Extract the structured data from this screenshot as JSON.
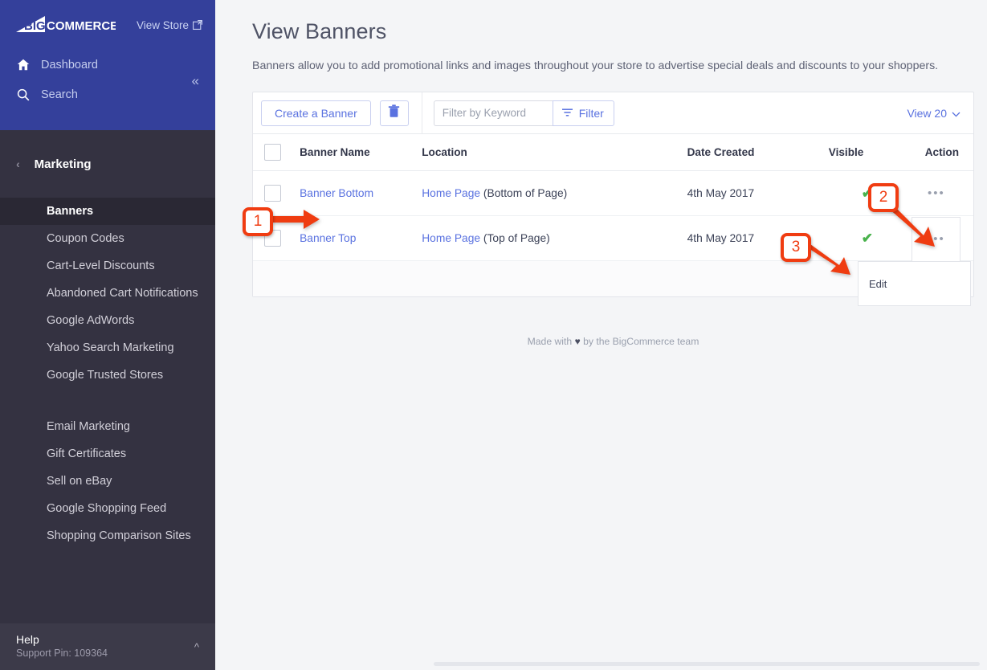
{
  "sidebar": {
    "brand": "BIGCOMMERCE",
    "view_store": "View Store",
    "view_store_icon": "external-link-icon",
    "nav": [
      {
        "label": "Dashboard",
        "icon": "home-icon"
      },
      {
        "label": "Search",
        "icon": "search-icon"
      }
    ],
    "collapse_icon": "chevron-double-left-icon",
    "section": {
      "label": "Marketing",
      "back_icon": "chevron-left-icon"
    },
    "items": [
      {
        "label": "Banners",
        "active": true
      },
      {
        "label": "Coupon Codes",
        "active": false
      },
      {
        "label": "Cart-Level Discounts",
        "active": false
      },
      {
        "label": "Abandoned Cart Notifications",
        "active": false
      },
      {
        "label": "Google AdWords",
        "active": false
      },
      {
        "label": "Yahoo Search Marketing",
        "active": false
      },
      {
        "label": "Google Trusted Stores",
        "active": false
      }
    ],
    "items2": [
      {
        "label": "Email Marketing"
      },
      {
        "label": "Gift Certificates"
      },
      {
        "label": "Sell on eBay"
      },
      {
        "label": "Google Shopping Feed"
      },
      {
        "label": "Shopping Comparison Sites"
      }
    ],
    "help": {
      "title": "Help",
      "support_pin": "Support Pin: 109364",
      "chevron_icon": "chevron-up-icon"
    }
  },
  "page": {
    "title": "View Banners",
    "description": "Banners allow you to add promotional links and images throughout your store to advertise special deals and discounts to your shoppers."
  },
  "toolbar": {
    "create_label": "Create a Banner",
    "delete_icon": "trash-icon",
    "filter_placeholder": "Filter by Keyword",
    "filter_value": "",
    "filter_label": "Filter",
    "filter_icon": "filter-icon",
    "view_count_label": "View 20",
    "view_count_icon": "chevron-down-icon"
  },
  "table": {
    "columns": [
      "Banner Name",
      "Location",
      "Date Created",
      "Visible",
      "Action"
    ],
    "rows": [
      {
        "name": "Banner Bottom",
        "location_link": "Home Page",
        "location_sub": "(Bottom of Page)",
        "date": "4th May 2017",
        "visible": "✔",
        "action_icon": "ellipsis-icon",
        "menu_open": false
      },
      {
        "name": "Banner Top",
        "location_link": "Home Page",
        "location_sub": "(Top of Page)",
        "date": "4th May 2017",
        "visible": "✔",
        "action_icon": "ellipsis-icon",
        "menu_open": true
      }
    ]
  },
  "dropdown": {
    "items": [
      "Edit"
    ]
  },
  "footer": {
    "prefix": "Made with",
    "heart": "♥",
    "suffix": "by the BigCommerce team"
  },
  "callouts": [
    {
      "label": "1"
    },
    {
      "label": "2"
    },
    {
      "label": "3"
    }
  ],
  "colors": {
    "nav_blue": "#34409b",
    "sidebar": "#343241",
    "sidebar_active": "#2a2834",
    "link_blue": "#5a72e0",
    "check_green": "#49b24c",
    "callout_red": "#f03c11",
    "page_bg": "#f4f5f7"
  }
}
